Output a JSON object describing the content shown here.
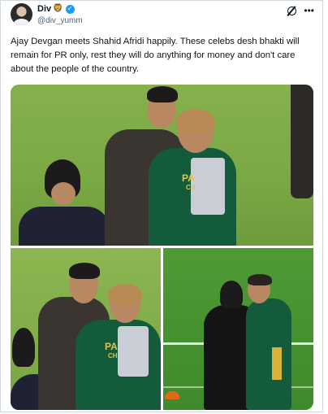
{
  "author": {
    "display_name": "Div",
    "emoji": "🦁",
    "verified_icon": "verified-badge-icon",
    "handle": "@div_yumm"
  },
  "icons": {
    "grok": "grok-icon",
    "more": "more-options-icon"
  },
  "tweet": {
    "text": "Ajay Devgan meets Shahid Afridi happily. These celebs desh bhakti will remain for PR only, rest they will do anything for money and don't care about the people of the country."
  },
  "media": {
    "jersey_text_top": "PA",
    "jersey_text_top_2": "CH",
    "jersey_text_bottom": "PA",
    "jersey_text_bottom_2": "CH",
    "colors": {
      "grass": "#7aa843",
      "jersey_green": "#135b3a",
      "accent": "#1d9bf0"
    }
  }
}
